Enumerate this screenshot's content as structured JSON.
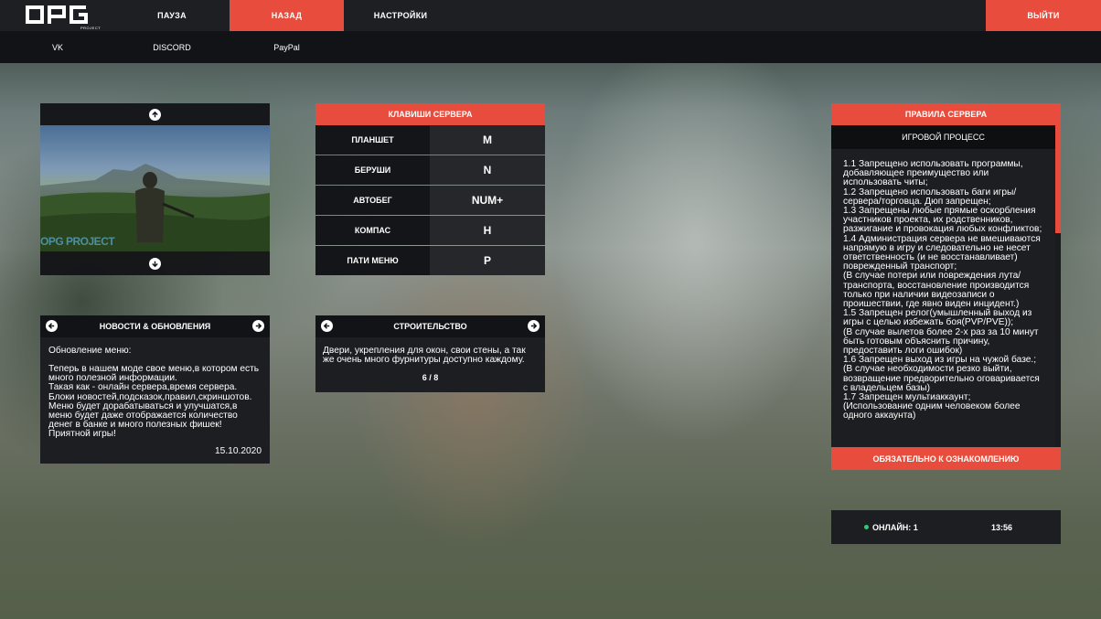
{
  "header": {
    "logo": "OPG",
    "logo_sub": "PROJECT",
    "nav": [
      {
        "label": "ПАУЗА",
        "active": false
      },
      {
        "label": "НАЗАД",
        "active": true
      },
      {
        "label": "НАСТРОЙКИ",
        "active": false
      }
    ],
    "exit_label": "ВЫЙТИ"
  },
  "subnav": [
    "VK",
    "DISCORD",
    "PayPal"
  ],
  "gallery": {
    "image_caption": "OPG PROJECT"
  },
  "keys": {
    "title": "КЛАВИШИ СЕРВЕРА",
    "rows": [
      {
        "action": "ПЛАНШЕТ",
        "key": "M"
      },
      {
        "action": "БЕРУШИ",
        "key": "N"
      },
      {
        "action": "АВТОБЕГ",
        "key": "NUM+"
      },
      {
        "action": "КОМПАС",
        "key": "H"
      },
      {
        "action": "ПАТИ МЕНЮ",
        "key": "P"
      }
    ]
  },
  "news": {
    "title": "НОВОСТИ & ОБНОВЛЕНИЯ",
    "heading": "Обновление меню:",
    "body": "Теперь в нашем моде свое меню,в котором есть много полезной информации.\nТакая как - онлайн сервера,время сервера.\nБлоки новостей,подсказок,правил,скриншотов.\nМеню будет дорабатываться и улучшатся,в меню будет даже отображается количество денег в банке и много полезных фишек!\nПриятной игры!",
    "date": "15.10.2020"
  },
  "building": {
    "title": "СТРОИТЕЛЬСТВО",
    "text": "Двери, укрепления для окон, свои стены, а так же очень много фурнитуры доступно каждому.",
    "page": "6 / 8"
  },
  "rules": {
    "title": "ПРАВИЛА СЕРВЕРА",
    "section": "ИГРОВОЙ ПРОЦЕСС",
    "lines": [
      "1.1 Запрещено использовать программы, добавляющее преимущество или использовать читы;",
      "1.2 Запрещено использовать баги игры/сервера/торговца. Дюп запрещен;",
      "1.3 Запрещены любые прямые оскорбления участников проекта, их родственников, разжигание и провокация любых конфликтов;",
      "1.4 Администрация сервера не вмешиваются напрямую в игру и следовательно не несет ответственность (и не восстанавливает) поврежденный транспорт;",
      "(В случае потери или повреждения лута/транспорта, восстановление производится только при наличии видеозаписи о проишествии, где явно виден инцидент.)",
      "1.5 Запрещен релог(умышленный выход из игры с целью избежать боя(PVP/PVE));",
      "(В случае вылетов более 2-х раз за 10 минут быть готовым объяснить причину, предоставить логи ошибок)",
      "1.6 Запрещен выход из игры на чужой базе.;",
      "(В случае необходимости резко выйти, возвращение предворительно оговаривается с владельцем базы)",
      "1.7 Запрещен мультиаккаунт;",
      "(Использование одним человеком более одного аккаунта)"
    ],
    "footer": "ОБЯЗАТЕЛЬНО К ОЗНАКОМЛЕНИЮ"
  },
  "status": {
    "online_label": "ОНЛАЙН: 1",
    "time": "13:56"
  },
  "colors": {
    "accent": "#e74c3c",
    "online_dot": "#2ecc71"
  }
}
